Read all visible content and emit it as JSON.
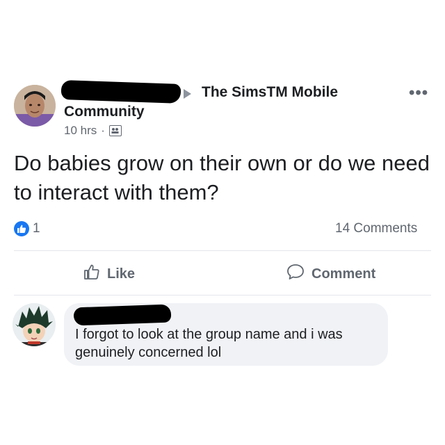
{
  "post": {
    "group_name": "The SimsTM Mobile",
    "group_type": "Community",
    "time": "10 hrs",
    "separator": "·",
    "text": "Do babies grow on their own or do we need to interact with them?",
    "reactions_count": "1",
    "comments_count": "14 Comments",
    "icons": {
      "more": "more-options-icon",
      "audience": "group-audience-icon",
      "reaction": "like-reaction-icon"
    }
  },
  "actions": {
    "like_label": "Like",
    "comment_label": "Comment"
  },
  "comment": {
    "text": "I forgot to look at the group name and i was genuinely concerned lol"
  },
  "colors": {
    "accent": "#1877f2",
    "muted_text": "#606770",
    "bubble_bg": "#f0f2f5",
    "redaction": "#000000"
  }
}
